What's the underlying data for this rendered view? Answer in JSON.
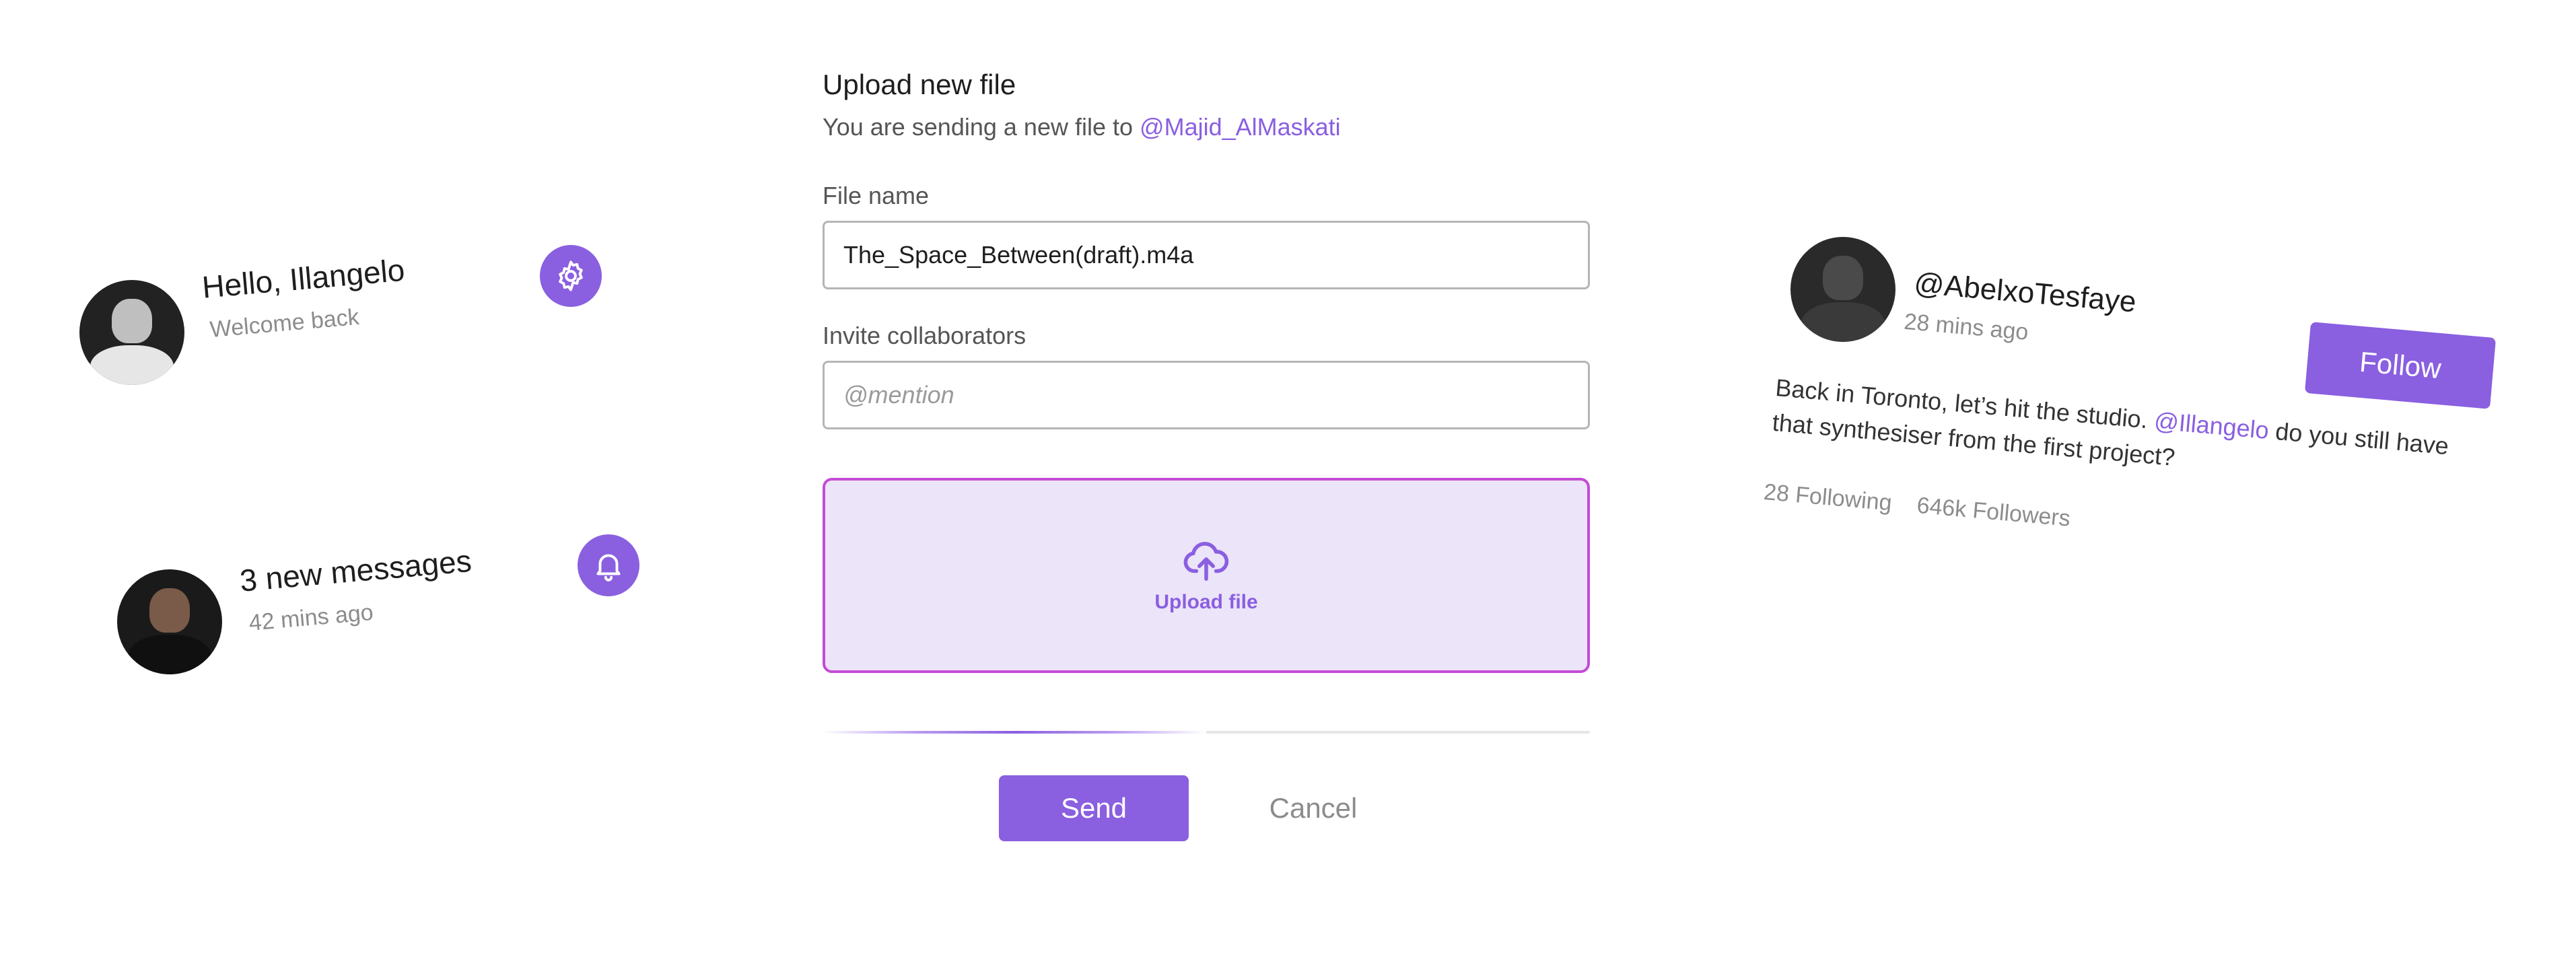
{
  "greeting_card": {
    "title": "Hello, Illangelo",
    "subtitle": "Welcome back",
    "settings_icon": "gear-icon"
  },
  "messages_card": {
    "title": "3 new messages",
    "time": "42 mins ago",
    "notification_icon": "bell-icon"
  },
  "upload_form": {
    "title": "Upload new file",
    "subtitle_prefix": "You are sending a new file to",
    "recipient": "@Majid_AlMaskati",
    "file_name_label": "File name",
    "file_name_value": "The_Space_Between(draft).m4a",
    "collaborators_label": "Invite collaborators",
    "collaborators_placeholder": "@mention",
    "dropzone_label": "Upload file",
    "dropzone_icon": "cloud-upload-icon",
    "progress": 0.5,
    "send_label": "Send",
    "cancel_label": "Cancel"
  },
  "post_card": {
    "handle": "@AbelxoTesfaye",
    "time": "28 mins ago",
    "follow_label": "Follow",
    "body_prefix": "Back in Toronto, let’s hit the studio.",
    "body_mention": "@Illangelo",
    "body_suffix": "do you still have that synthesiser from the first project?",
    "following": "28 Following",
    "followers": "646k Followers"
  },
  "colors": {
    "accent": "#8a5fe0",
    "dropzone_border": "#c44bd6",
    "dropzone_fill": "#ece4f9"
  }
}
